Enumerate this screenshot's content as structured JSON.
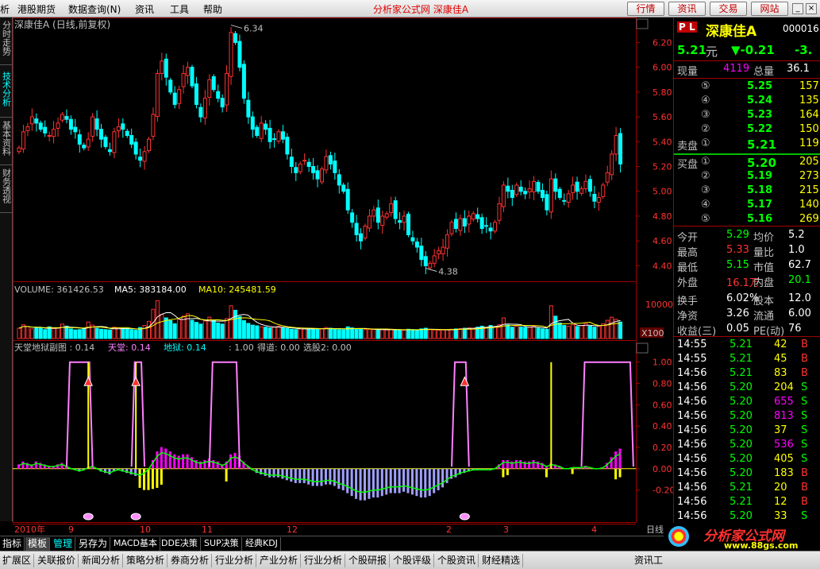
{
  "menubar": {
    "items": [
      "析",
      "港股期货",
      "数据查询(N)",
      "资讯",
      "工具",
      "帮助"
    ],
    "center_title": "分析家公式网  深康佳A",
    "right_buttons": [
      "行情",
      "资讯",
      "交易",
      "网站"
    ]
  },
  "left_tabs": [
    "分时走势",
    "技术分析",
    "基本资料",
    "财务透视"
  ],
  "main_chart": {
    "title": "深康佳A (日线,前复权)",
    "high_label": "6.34",
    "low_label": "4.38",
    "y_ticks": [
      "6.20",
      "6.00",
      "5.80",
      "5.60",
      "5.40",
      "5.20",
      "5.00",
      "4.80",
      "4.60",
      "4.40"
    ]
  },
  "volume_panel": {
    "volume_label": "VOLUME: 361426.53",
    "ma5_label": "MA5: 383184.00",
    "ma10_label": "MA10: 245481.59",
    "y_tick": "10000",
    "unit": "X100"
  },
  "indicator_panel": {
    "name_label": "天堂地狱副图 : 0.14",
    "tiantang_label": "天堂: 0.14",
    "diyu_label": "地狱: 0.14",
    "val_label": ": 1.00",
    "dedao_label": "得道: 0.00",
    "xuangu_label": "选股2: 0.00",
    "y_ticks": [
      "1.00",
      "0.80",
      "0.60",
      "0.40",
      "0.20",
      "0.00",
      "-0.20"
    ]
  },
  "time_axis": {
    "labels": [
      "2010年",
      "9",
      "10",
      "11",
      "12",
      "2",
      "3",
      "4"
    ],
    "right_label": "日线"
  },
  "chart_data": [
    {
      "type": "candlestick",
      "title": "深康佳A (日线,前复权)",
      "ylim": [
        4.3,
        6.35
      ],
      "annotations": [
        {
          "label": "6.34",
          "value": 6.34
        },
        {
          "label": "4.38",
          "value": 4.38
        }
      ],
      "close": [
        5.35,
        5.48,
        5.52,
        5.6,
        5.55,
        5.5,
        5.47,
        5.45,
        5.5,
        5.55,
        5.62,
        5.58,
        5.5,
        5.48,
        5.38,
        5.35,
        5.42,
        5.6,
        5.5,
        5.42,
        5.36,
        5.32,
        5.48,
        5.52,
        5.5,
        5.45,
        5.38,
        5.3,
        5.25,
        5.32,
        5.42,
        5.62,
        5.95,
        6.05,
        5.92,
        5.8,
        5.7,
        5.82,
        5.95,
        6.0,
        5.85,
        5.7,
        5.6,
        5.75,
        5.9,
        5.82,
        5.75,
        5.68,
        5.95,
        6.28,
        6.2,
        6.0,
        5.75,
        5.6,
        5.5,
        5.45,
        5.55,
        5.5,
        5.4,
        5.42,
        5.48,
        5.42,
        5.3,
        5.2,
        5.15,
        5.22,
        5.25,
        5.2,
        5.15,
        5.1,
        5.18,
        5.28,
        5.22,
        5.15,
        5.05,
        5.0,
        4.85,
        4.75,
        4.65,
        4.6,
        4.72,
        4.8,
        4.85,
        4.75,
        4.8,
        4.82,
        4.9,
        4.78,
        4.75,
        4.8,
        4.65,
        4.6,
        4.55,
        4.45,
        4.4,
        4.42,
        4.48,
        4.52,
        4.55,
        4.65,
        4.75,
        4.7,
        4.78,
        4.72,
        4.8,
        4.82,
        4.78,
        4.7,
        4.72,
        4.68,
        4.75,
        4.9,
        5.05,
        5.0,
        4.95,
        5.05,
        5.0,
        4.98,
        5.02,
        5.08,
        5.0,
        4.95,
        4.85,
        5.1,
        5.0,
        4.95,
        4.92,
        4.98,
        5.05,
        5.0,
        5.02,
        5.08,
        5.0,
        4.92,
        4.95,
        5.05,
        5.15,
        5.3,
        5.45,
        5.22
      ]
    },
    {
      "type": "bar",
      "title": "VOLUME: 361426.53",
      "series": [
        {
          "name": "MA5: 383184.00"
        },
        {
          "name": "MA10: 245481.59"
        }
      ],
      "values": [
        3000,
        4000,
        3500,
        2800,
        3200,
        3000,
        2600,
        3400,
        2900,
        3100,
        4200,
        3600,
        2800,
        2500,
        2600,
        3000,
        4800,
        3900,
        3000,
        2700,
        2600,
        2500,
        3300,
        3100,
        2900,
        2800,
        2600,
        2400,
        3200,
        3800,
        5000,
        8500,
        11000,
        7000,
        6000,
        5200,
        4300,
        5600,
        6500,
        7200,
        5300,
        4700,
        4200,
        5100,
        6200,
        5200,
        4500,
        4200,
        5800,
        9500,
        8200,
        6400,
        5200,
        4400,
        3900,
        3700,
        3400,
        3300,
        3100,
        3300,
        3600,
        3100,
        2900,
        2700,
        2600,
        2800,
        3000,
        2900,
        2800,
        2600,
        2900,
        3200,
        3000,
        2700,
        2600,
        2500,
        3400,
        3100,
        2900,
        2700,
        2600,
        2700,
        2600,
        2500,
        2600,
        2500,
        2700,
        2600,
        2500,
        2400,
        2700,
        2600,
        2500,
        2800,
        3000,
        2600,
        2500,
        2400,
        2500,
        2600,
        2700,
        2800,
        2900,
        3000,
        3100,
        3000,
        3300,
        3600,
        3300,
        3800,
        3500,
        4000,
        6000,
        3900,
        3300,
        3600,
        3400,
        3200,
        3300,
        3500,
        3000,
        2800,
        2700,
        9500,
        6500,
        4500,
        3800,
        3600,
        4000,
        3500,
        3800,
        4400,
        3600,
        3300,
        3500,
        4300,
        5300,
        6200,
        5600,
        4800
      ]
    },
    {
      "type": "line",
      "title": "天堂地狱副图",
      "ylim": [
        -0.3,
        1.05
      ],
      "series": [
        {
          "name": "天堂: 0.14",
          "values": [
            0.03,
            0.05,
            0.04,
            0.03,
            0.05,
            0.04,
            0.03,
            0.02,
            0.02,
            0.03,
            0.04,
            0.02,
            0.0,
            -0.01,
            -0.02,
            -0.01,
            0.01,
            0.02,
            0.0,
            -0.02,
            -0.03,
            -0.04,
            -0.02,
            -0.01,
            -0.02,
            -0.03,
            -0.04,
            -0.05,
            -0.06,
            -0.04,
            0.0,
            0.06,
            0.12,
            0.15,
            0.14,
            0.12,
            0.1,
            0.09,
            0.1,
            0.1,
            0.08,
            0.06,
            0.05,
            0.06,
            0.07,
            0.06,
            0.05,
            0.03,
            0.05,
            0.1,
            0.11,
            0.09,
            0.05,
            0.02,
            -0.01,
            -0.03,
            -0.04,
            -0.05,
            -0.06,
            -0.06,
            -0.06,
            -0.07,
            -0.08,
            -0.09,
            -0.1,
            -0.1,
            -0.1,
            -0.11,
            -0.12,
            -0.12,
            -0.12,
            -0.11,
            -0.11,
            -0.12,
            -0.14,
            -0.15,
            -0.17,
            -0.19,
            -0.21,
            -0.22,
            -0.22,
            -0.21,
            -0.2,
            -0.2,
            -0.19,
            -0.18,
            -0.17,
            -0.17,
            -0.17,
            -0.16,
            -0.17,
            -0.18,
            -0.19,
            -0.2,
            -0.2,
            -0.19,
            -0.17,
            -0.15,
            -0.13,
            -0.1,
            -0.07,
            -0.06,
            -0.04,
            -0.03,
            -0.02,
            -0.01,
            -0.01,
            -0.01,
            -0.01,
            -0.01,
            0.0,
            0.03,
            0.06,
            0.06,
            0.05,
            0.06,
            0.06,
            0.05,
            0.05,
            0.06,
            0.05,
            0.04,
            0.02,
            0.04,
            0.03,
            0.02,
            0.0,
            0.0,
            0.01,
            0.01,
            0.01,
            0.02,
            0.01,
            0.0,
            0.0,
            0.01,
            0.04,
            0.08,
            0.12,
            0.14
          ]
        }
      ]
    }
  ],
  "quote": {
    "pl_badge": "P L",
    "stock_name": "深康佳A",
    "stock_code": "000016",
    "price": "5.21",
    "price_unit": "元",
    "change": "▼-0.21",
    "change_pct": "-3.",
    "xianliang_label": "现量",
    "xianliang": "4119",
    "zongliang_label": "总量",
    "zongliang": "36.1",
    "sell": [
      {
        "lv": "⑤",
        "price": "5.25",
        "vol": "157"
      },
      {
        "lv": "④",
        "price": "5.24",
        "vol": "135"
      },
      {
        "lv": "③",
        "price": "5.23",
        "vol": "164"
      },
      {
        "lv": "②",
        "price": "5.22",
        "vol": "150"
      },
      {
        "lv": "①",
        "price": "5.21",
        "vol": "119"
      }
    ],
    "sell_label": "卖盘",
    "buy_label": "买盘",
    "buy": [
      {
        "lv": "①",
        "price": "5.20",
        "vol": "205"
      },
      {
        "lv": "②",
        "price": "5.19",
        "vol": "273"
      },
      {
        "lv": "③",
        "price": "5.18",
        "vol": "215"
      },
      {
        "lv": "④",
        "price": "5.17",
        "vol": "140"
      },
      {
        "lv": "⑤",
        "price": "5.16",
        "vol": "269"
      }
    ],
    "stats": [
      [
        "今开",
        "5.29",
        "均价",
        "5.2"
      ],
      [
        "最高",
        "5.33",
        "量比",
        "1.0"
      ],
      [
        "最低",
        "5.15",
        "市值",
        "62.7"
      ],
      [
        "外盘",
        "16.1万",
        "内盘",
        "20.1"
      ],
      [
        "换手",
        "6.02%",
        "股本",
        "12.0"
      ],
      [
        "净资",
        "3.26",
        "流通",
        "6.00"
      ],
      [
        "收益(三)",
        "0.05",
        "PE(动)",
        "76"
      ]
    ],
    "ticks": [
      [
        "14:55",
        "5.21",
        "42",
        "B"
      ],
      [
        "14:55",
        "5.21",
        "45",
        "B"
      ],
      [
        "14:56",
        "5.21",
        "83",
        "B"
      ],
      [
        "14:56",
        "5.20",
        "204",
        "S"
      ],
      [
        "14:56",
        "5.20",
        "655",
        "S"
      ],
      [
        "14:56",
        "5.20",
        "813",
        "S"
      ],
      [
        "14:56",
        "5.20",
        "37",
        "S"
      ],
      [
        "14:56",
        "5.20",
        "536",
        "S"
      ],
      [
        "14:56",
        "5.20",
        "405",
        "S"
      ],
      [
        "14:56",
        "5.20",
        "183",
        "B"
      ],
      [
        "14:56",
        "5.21",
        "20",
        "B"
      ],
      [
        "14:56",
        "5.21",
        "12",
        "B"
      ],
      [
        "14:56",
        "5.20",
        "33",
        "S"
      ]
    ]
  },
  "bottom_tabs": [
    "指标",
    "模板",
    "管理",
    "另存为",
    "MACD基本",
    "DDE决策",
    "SUP决策",
    "经典KDJ"
  ],
  "bottom_bar2": [
    "扩展区",
    "关联报价",
    "新闻分析",
    "策略分析",
    "券商分析",
    "行业分析",
    "产业分析",
    "行业分析",
    "个股研报",
    "个股评级",
    "个股资讯",
    "财经精选",
    "资讯工"
  ],
  "watermark": {
    "site_cn": "分析家公式网",
    "url": "www.88gs.com"
  },
  "colors": {
    "up": "#ff3232",
    "down": "#00ffff",
    "ma5": "#ffffff",
    "ma10": "#ffff00",
    "heaven": "#ff80ff",
    "line": "#00ff00",
    "bar_pos": "#ff00ff",
    "bar_neg": "#ffff00"
  }
}
